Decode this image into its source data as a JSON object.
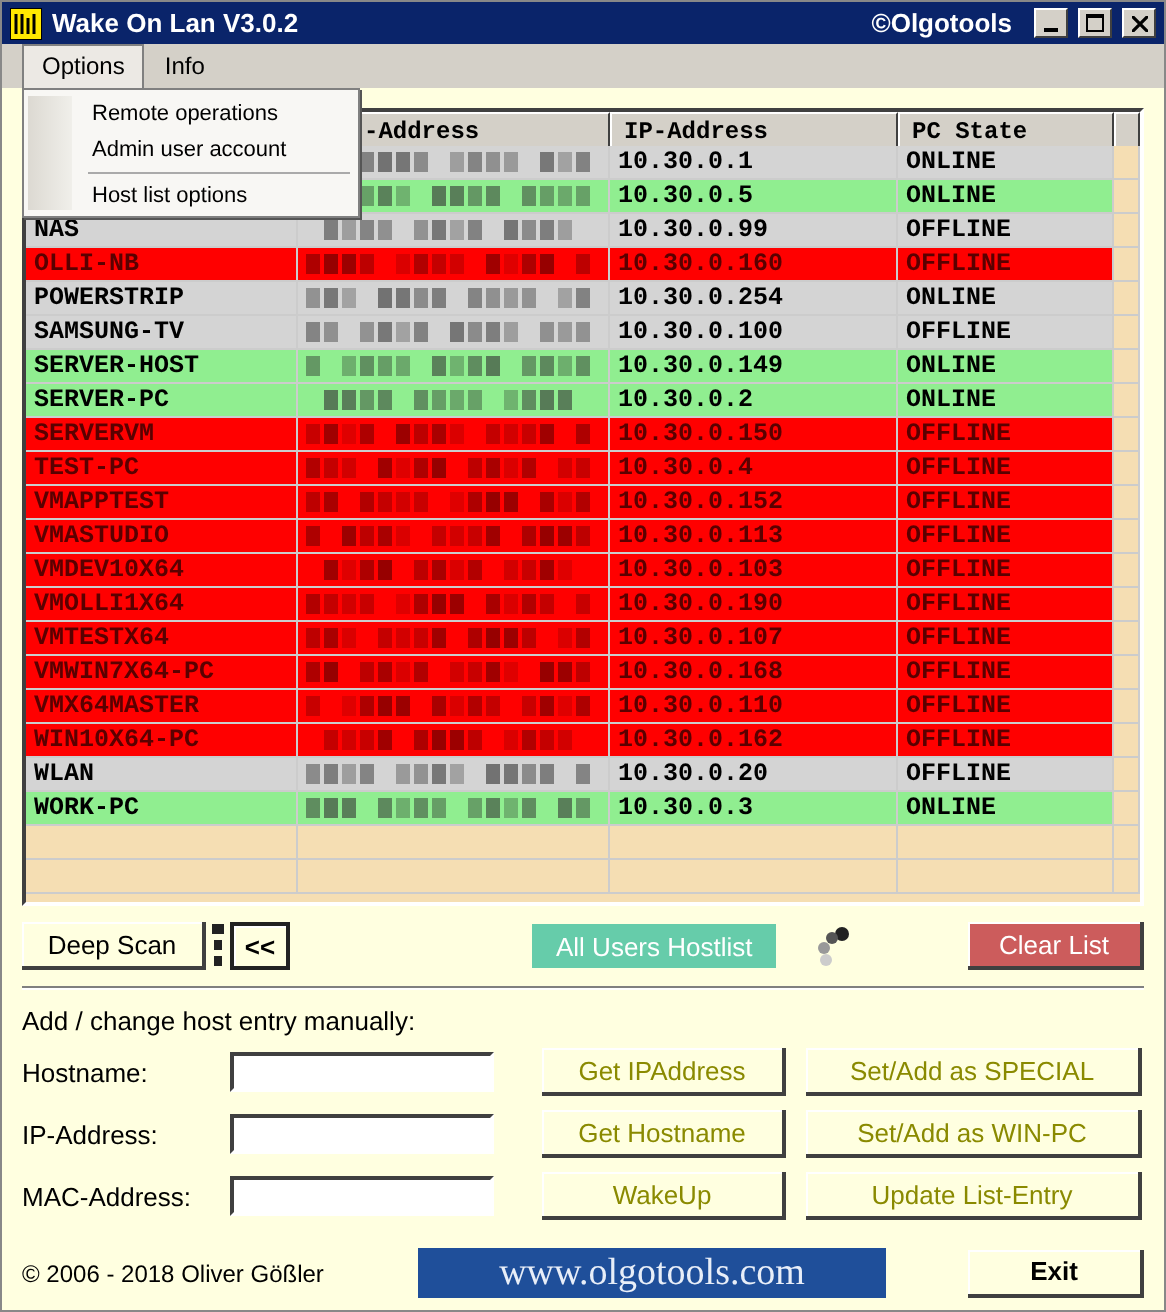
{
  "window": {
    "title": "Wake On Lan V3.0.2",
    "brand": "©Olgotools"
  },
  "menu": [
    {
      "label": "Options",
      "selected": true
    },
    {
      "label": "Info",
      "selected": false
    }
  ],
  "dropdown": [
    {
      "kind": "item",
      "label": "Remote operations"
    },
    {
      "kind": "item",
      "label": "Admin user account"
    },
    {
      "kind": "separator"
    },
    {
      "kind": "item",
      "label": "Host list options"
    }
  ],
  "table": {
    "columns": [
      {},
      {
        "label": "-Address"
      },
      {
        "label": "IP-Address"
      },
      {
        "label": "PC State"
      },
      {}
    ],
    "rows": [
      {
        "ip": "10.30.0.1",
        "state": "ONLINE",
        "color": "#d4d4d4"
      },
      {
        "ip": "10.30.0.5",
        "state": "ONLINE",
        "color": "#90ee90"
      },
      {
        "name": "NAS",
        "ip": "10.30.0.99",
        "state": "OFFLINE",
        "color": "#d4d4d4"
      },
      {
        "name": "OLLI-NB",
        "ip": "10.30.0.160",
        "state": "OFFLINE",
        "color": "#ff0000"
      },
      {
        "name": "POWERSTRIP",
        "ip": "10.30.0.254",
        "state": "ONLINE",
        "color": "#d4d4d4"
      },
      {
        "name": "SAMSUNG-TV",
        "ip": "10.30.0.100",
        "state": "OFFLINE",
        "color": "#d4d4d4"
      },
      {
        "name": "SERVER-HOST",
        "ip": "10.30.0.149",
        "state": "ONLINE",
        "color": "#90ee90"
      },
      {
        "name": "SERVER-PC",
        "ip": "10.30.0.2",
        "state": "ONLINE",
        "color": "#90ee90"
      },
      {
        "name": "SERVERVM",
        "ip": "10.30.0.150",
        "state": "OFFLINE",
        "color": "#ff0000"
      },
      {
        "name": "TEST-PC",
        "ip": "10.30.0.4",
        "state": "OFFLINE",
        "color": "#ff0000"
      },
      {
        "name": "VMAPPTEST",
        "ip": "10.30.0.152",
        "state": "OFFLINE",
        "color": "#ff0000"
      },
      {
        "name": "VMASTUDIO",
        "ip": "10.30.0.113",
        "state": "OFFLINE",
        "color": "#ff0000"
      },
      {
        "name": "VMDEV10X64",
        "ip": "10.30.0.103",
        "state": "OFFLINE",
        "color": "#ff0000"
      },
      {
        "name": "VMOLLI1X64",
        "ip": "10.30.0.190",
        "state": "OFFLINE",
        "color": "#ff0000"
      },
      {
        "name": "VMTESTX64",
        "ip": "10.30.0.107",
        "state": "OFFLINE",
        "color": "#ff0000"
      },
      {
        "name": "VMWIN7X64-PC",
        "ip": "10.30.0.168",
        "state": "OFFLINE",
        "color": "#ff0000"
      },
      {
        "name": "VMX64MASTER",
        "ip": "10.30.0.110",
        "state": "OFFLINE",
        "color": "#ff0000"
      },
      {
        "name": "WIN10X64-PC",
        "ip": "10.30.0.162",
        "state": "OFFLINE",
        "color": "#ff0000"
      },
      {
        "name": "WLAN",
        "ip": "10.30.0.20",
        "state": "OFFLINE",
        "color": "#d4d4d4"
      },
      {
        "name": "WORK-PC",
        "ip": "10.30.0.3",
        "state": "ONLINE",
        "color": "#90ee90"
      }
    ]
  },
  "toolbar": {
    "deep_scan": "Deep Scan",
    "collapse": "<<",
    "all_users": "All Users Hostlist",
    "clear": "Clear List"
  },
  "form": {
    "heading": "Add / change host entry manually:",
    "fields": [
      {
        "label": "Hostname:"
      },
      {
        "label": "IP-Address:"
      },
      {
        "label": "MAC-Address:"
      }
    ],
    "buttons": [
      "Get IPAddress",
      "Set/Add as SPECIAL",
      "Get Hostname",
      "Set/Add as WIN-PC",
      "WakeUp",
      "Update List-Entry"
    ]
  },
  "footer": {
    "copyright": "© 2006 - 2018  Oliver Gößler",
    "logo": "www.olgotools.com",
    "exit": "Exit"
  }
}
